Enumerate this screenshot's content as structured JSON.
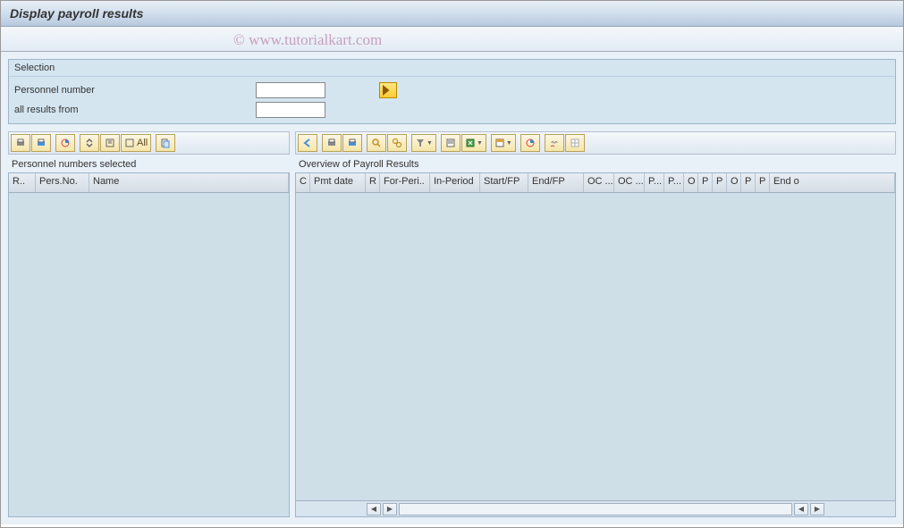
{
  "page": {
    "title": "Display payroll results"
  },
  "watermark": "© www.tutorialkart.com",
  "selection": {
    "title": "Selection",
    "personnel_label": "Personnel number",
    "personnel_value": "",
    "all_results_label": "all results from",
    "all_results_value": ""
  },
  "left_panel": {
    "title": "Personnel numbers selected",
    "toolbar": {
      "print": "Print",
      "export": "Export",
      "chart": "Chart",
      "expand": "Expand",
      "collapse": "Collapse",
      "all": "All",
      "clipboard": "Clipboard"
    },
    "columns": [
      "R..",
      "Pers.No.",
      "Name"
    ]
  },
  "right_panel": {
    "title": "Overview of Payroll Results",
    "toolbar": {
      "back": "Back",
      "print": "Print",
      "export": "Export",
      "find": "Find",
      "find_next": "Find Next",
      "filter": "Filter",
      "sort": "Sort",
      "spreadsheet": "Spreadsheet",
      "layout": "Layout",
      "chart": "Chart",
      "link": "Link",
      "grid": "Grid"
    },
    "columns": [
      "C",
      "Pmt date",
      "R",
      "For-Peri..",
      "In-Period",
      "Start/FP",
      "End/FP",
      "OC ...",
      "OC ...",
      "P...",
      "P...",
      "O",
      "P",
      "P",
      "O",
      "P",
      "P",
      "End o"
    ]
  }
}
